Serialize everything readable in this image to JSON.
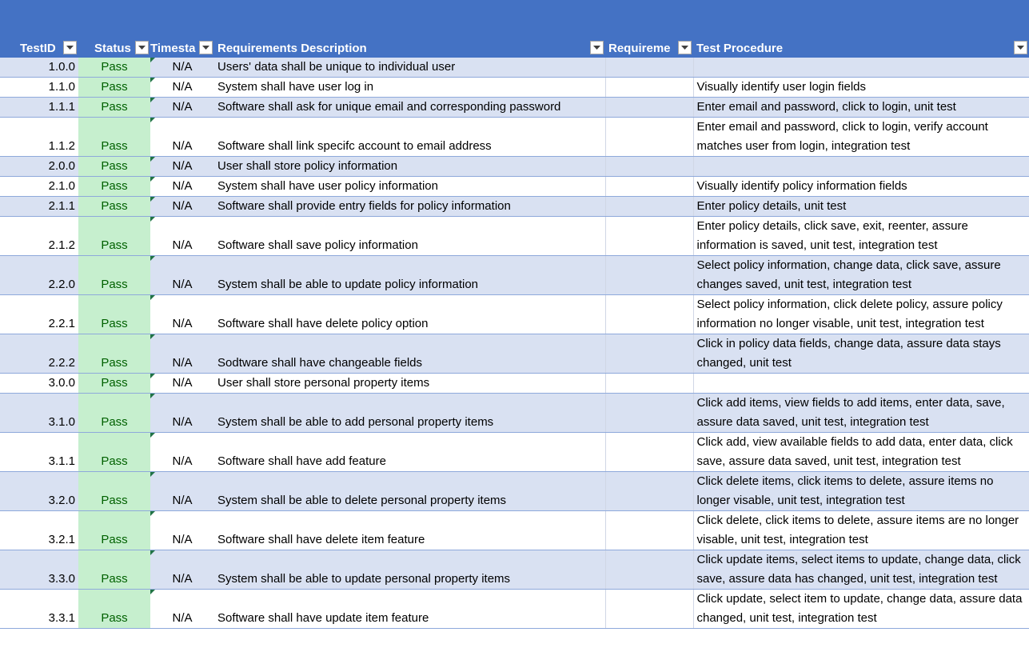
{
  "header": {
    "columns": [
      "TestID",
      "Status",
      "Timesta",
      "Requirements Description",
      "Requireme",
      "Test Procedure"
    ]
  },
  "colors": {
    "header_fill": "#4472c4",
    "band_fill": "#d9e1f2",
    "pass_fill": "#c6efce",
    "pass_text": "#006100"
  },
  "icons": {
    "filter": "dropdown-arrow-icon",
    "cell_marker": "green-triangle-icon"
  },
  "rows": [
    {
      "id": "1.0.0",
      "status": "Pass",
      "time": "N/A",
      "desc": "Users' data shall be unique to individual user",
      "req": "",
      "proc": ""
    },
    {
      "id": "1.1.0",
      "status": "Pass",
      "time": "N/A",
      "desc": "System shall have user log in",
      "req": "",
      "proc": "Visually identify user login fields"
    },
    {
      "id": "1.1.1",
      "status": "Pass",
      "time": "N/A",
      "desc": "Software shall ask for unique email and corresponding password",
      "req": "",
      "proc": "Enter email and password, click to login, unit test"
    },
    {
      "id": "1.1.2",
      "status": "Pass",
      "time": "N/A",
      "desc": "Software shall link specifc account to email address",
      "req": "",
      "proc": "Enter email and password, click to login, verify account matches user from login, integration test"
    },
    {
      "id": "2.0.0",
      "status": "Pass",
      "time": "N/A",
      "desc": "User shall store policy information",
      "req": "",
      "proc": ""
    },
    {
      "id": "2.1.0",
      "status": "Pass",
      "time": "N/A",
      "desc": "System shall have user policy information",
      "req": "",
      "proc": "Visually identify policy information fields"
    },
    {
      "id": "2.1.1",
      "status": "Pass",
      "time": "N/A",
      "desc": "Software shall provide entry fields for policy information",
      "req": "",
      "proc": "Enter policy details, unit test"
    },
    {
      "id": "2.1.2",
      "status": "Pass",
      "time": "N/A",
      "desc": "Software shall save policy information",
      "req": "",
      "proc": "Enter policy details, click save, exit, reenter, assure information is saved, unit test, integration test"
    },
    {
      "id": "2.2.0",
      "status": "Pass",
      "time": "N/A",
      "desc": "System shall be able to update policy information",
      "req": "",
      "proc": "Select policy information, change data, click save, assure changes saved, unit test, integration test"
    },
    {
      "id": "2.2.1",
      "status": "Pass",
      "time": "N/A",
      "desc": "Software shall have delete policy option",
      "req": "",
      "proc": "Select policy information, click delete policy, assure policy information no longer visable, unit test, integration test"
    },
    {
      "id": "2.2.2",
      "status": "Pass",
      "time": "N/A",
      "desc": "Sodtware shall have changeable fields",
      "req": "",
      "proc": "Click in policy data fields, change data, assure data stays changed, unit test"
    },
    {
      "id": "3.0.0",
      "status": "Pass",
      "time": "N/A",
      "desc": "User shall store personal property items",
      "req": "",
      "proc": ""
    },
    {
      "id": "3.1.0",
      "status": "Pass",
      "time": "N/A",
      "desc": "System shall be able to add personal property items",
      "req": "",
      "proc": "Click add items, view fields to add items, enter data, save, assure data saved, unit test, integration test"
    },
    {
      "id": "3.1.1",
      "status": "Pass",
      "time": "N/A",
      "desc": "Software shall have add feature",
      "req": "",
      "proc": "Click add, view available fields to add data, enter data, click save, assure data saved, unit test, integration test"
    },
    {
      "id": "3.2.0",
      "status": "Pass",
      "time": "N/A",
      "desc": "System shall be able to delete personal property items",
      "req": "",
      "proc": "Click delete items, click items to delete, assure items no longer visable, unit test, integration test"
    },
    {
      "id": "3.2.1",
      "status": "Pass",
      "time": "N/A",
      "desc": "Software shall have delete item feature",
      "req": "",
      "proc": "Click delete, click items to delete, assure items are no longer visable, unit test, integration test"
    },
    {
      "id": "3.3.0",
      "status": "Pass",
      "time": "N/A",
      "desc": "System shall be able to update personal property items",
      "req": "",
      "proc": "Click update items, select items to update, change data, click save, assure data has changed, unit test, integration test"
    },
    {
      "id": "3.3.1",
      "status": "Pass",
      "time": "N/A",
      "desc": "Software shall have update item feature",
      "req": "",
      "proc": "Click update, select item to update, change data, assure data changed, unit test, integration test"
    }
  ]
}
